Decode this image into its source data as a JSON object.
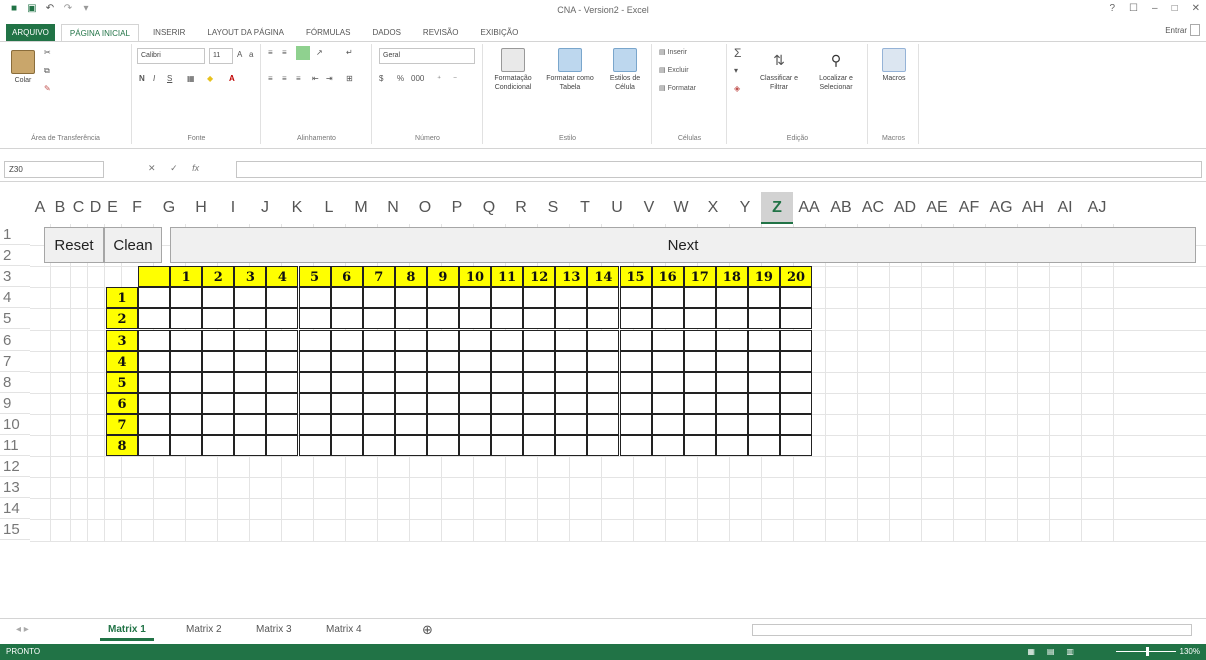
{
  "window": {
    "title": "CNA - Version2 - Excel",
    "controls": [
      "?",
      "☐",
      "–",
      "□",
      "✕"
    ]
  },
  "ribbon_tabs": [
    "ARQUIVO",
    "PÁGINA INICIAL",
    "INSERIR",
    "LAYOUT DA PÁGINA",
    "FÓRMULAS",
    "DADOS",
    "REVISÃO",
    "EXIBIÇÃO"
  ],
  "sign_in": "Entrar",
  "ribbon": {
    "clipboard": {
      "label": "Área de Transferência",
      "paste": "Colar"
    },
    "font": {
      "label": "Fonte",
      "font_name": "Calibri",
      "font_size": "11",
      "bold": "N",
      "italic": "I",
      "underline": "S"
    },
    "alignment": {
      "label": "Alinhamento"
    },
    "number": {
      "label": "Número",
      "format": "Geral",
      "percent": "%",
      "thousands": "000"
    },
    "styles": {
      "label": "Estilo",
      "conditional": "Formatação Condicional",
      "as_table": "Formatar como Tabela",
      "cell_styles": "Estilos de Célula"
    },
    "cells": {
      "label": "Células",
      "insert": "Inserir",
      "delete": "Excluir",
      "format": "Formatar"
    },
    "editing": {
      "label": "Edição",
      "sort": "Classificar e Filtrar",
      "find": "Localizar e Selecionar"
    },
    "macros": {
      "label": "Macros",
      "macros": "Macros"
    }
  },
  "formula_bar": {
    "name_box": "Z30",
    "cancel": "✕",
    "enter": "✓",
    "fx": "fx",
    "content": ""
  },
  "columns": [
    "A",
    "B",
    "C",
    "D",
    "E",
    "F",
    "G",
    "H",
    "I",
    "J",
    "K",
    "L",
    "M",
    "N",
    "O",
    "P",
    "Q",
    "R",
    "S",
    "T",
    "U",
    "V",
    "W",
    "X",
    "Y",
    "Z",
    "AA",
    "AB",
    "AC",
    "AD",
    "AE",
    "AF",
    "AG",
    "AH",
    "AI",
    "AJ"
  ],
  "selected_column": "Z",
  "rows": [
    "1",
    "2",
    "3",
    "4",
    "5",
    "6",
    "7",
    "8",
    "9",
    "10",
    "11",
    "12",
    "13",
    "14",
    "15"
  ],
  "buttons": {
    "reset": "Reset",
    "clean": "Clean",
    "next": "Next"
  },
  "matrix": {
    "col_headers": [
      "1",
      "2",
      "3",
      "4",
      "5",
      "6",
      "7",
      "8",
      "9",
      "10",
      "11",
      "12",
      "13",
      "14",
      "15",
      "16",
      "17",
      "18",
      "19",
      "20"
    ],
    "row_headers": [
      "1",
      "2",
      "3",
      "4",
      "5",
      "6",
      "7",
      "8"
    ]
  },
  "sheets": [
    "Matrix 1",
    "Matrix 2",
    "Matrix 3",
    "Matrix 4"
  ],
  "active_sheet": "Matrix 1",
  "add_sheet": "⊕",
  "status": {
    "mode": "PRONTO",
    "zoom": "130%"
  }
}
